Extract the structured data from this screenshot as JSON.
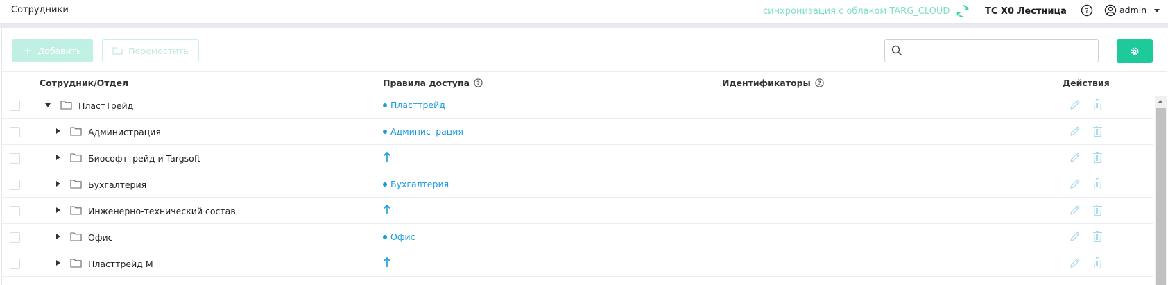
{
  "header": {
    "title": "Сотрудники",
    "sync_text": "синхронизация с облаком TARG_CLOUD",
    "site_name": "ТС Х0 Лестница",
    "user": "admin"
  },
  "toolbar": {
    "add_label": "Добавить",
    "move_label": "Переместить",
    "search_placeholder": ""
  },
  "table": {
    "columns": {
      "employee": "Сотрудник/Отдел",
      "access": "Правила доступа",
      "identifiers": "Идентификаторы",
      "actions": "Действия"
    },
    "rows": [
      {
        "name": "ПластТрейд",
        "access": "Пласттрейд",
        "level": 0,
        "expanded": true
      },
      {
        "name": "Администрация",
        "access": "Администрация",
        "level": 1,
        "expanded": false
      },
      {
        "name": "Биософттрейд и Targsoft",
        "access": null,
        "level": 1,
        "expanded": false
      },
      {
        "name": "Бухгалтерия",
        "access": "Бухгалтерия",
        "level": 1,
        "expanded": false
      },
      {
        "name": "Инженерно-технический состав",
        "access": null,
        "level": 1,
        "expanded": false
      },
      {
        "name": "Офис",
        "access": "Офис",
        "level": 1,
        "expanded": false
      },
      {
        "name": "Пласттрейд М",
        "access": null,
        "level": 1,
        "expanded": false
      }
    ]
  },
  "colors": {
    "accent": "#1ec99a",
    "link": "#1a9be0",
    "action_icon": "#a6dcee"
  }
}
